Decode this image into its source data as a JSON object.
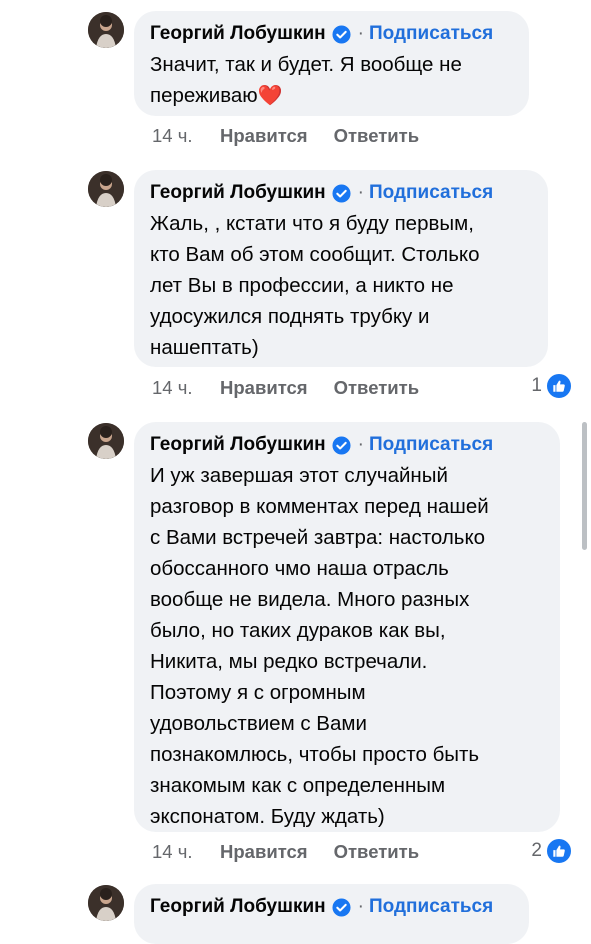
{
  "comments": [
    {
      "author": "Георгий Лобушкин",
      "follow_label": "Подписаться",
      "separator": "·",
      "lines": [
        "Значит, так и будет. Я вообще не",
        "переживаю"
      ],
      "emoji": "❤️",
      "time": "14 ч.",
      "like_label": "Нравится",
      "reply_label": "Ответить",
      "reactions_count": ""
    },
    {
      "author": "Георгий Лобушкин",
      "follow_label": "Подписаться",
      "separator": "·",
      "lines": [
        "Жаль, , кстати что я буду первым,",
        "кто Вам об этом сообщит. Столько",
        "лет Вы в профессии, а никто не",
        "удосужился поднять трубку и",
        "нашептать)"
      ],
      "time": "14 ч.",
      "like_label": "Нравится",
      "reply_label": "Ответить",
      "reactions_count": "1"
    },
    {
      "author": "Георгий Лобушкин",
      "follow_label": "Подписаться",
      "separator": "·",
      "lines": [
        "И уж завершая этот случайный",
        "разговор в комментах перед нашей",
        "с Вами встречей завтра: настолько",
        "обоссанного чмо наша отрасль",
        "вообще не видела. Много разных",
        "было, но таких дураков как вы,",
        "Никита, мы редко встречали.",
        "Поэтому я с огромным",
        "удовольствием с Вами",
        "познакомлюсь, чтобы просто быть",
        "знакомым как с определенным",
        "экспонатом. Буду ждать)"
      ],
      "time": "14 ч.",
      "like_label": "Нравится",
      "reply_label": "Ответить",
      "reactions_count": "2"
    },
    {
      "author": "Георгий Лобушкин",
      "follow_label": "Подписаться",
      "separator": "·"
    }
  ],
  "colors": {
    "bubble": "#f0f2f5",
    "link": "#216fdb",
    "meta": "#65676b",
    "like_badge": "#1877f2",
    "heart": "#e41e3f"
  },
  "icons": {
    "verified": "verified-badge-icon",
    "like": "thumbs-up-icon",
    "avatar": "avatar-photo"
  }
}
